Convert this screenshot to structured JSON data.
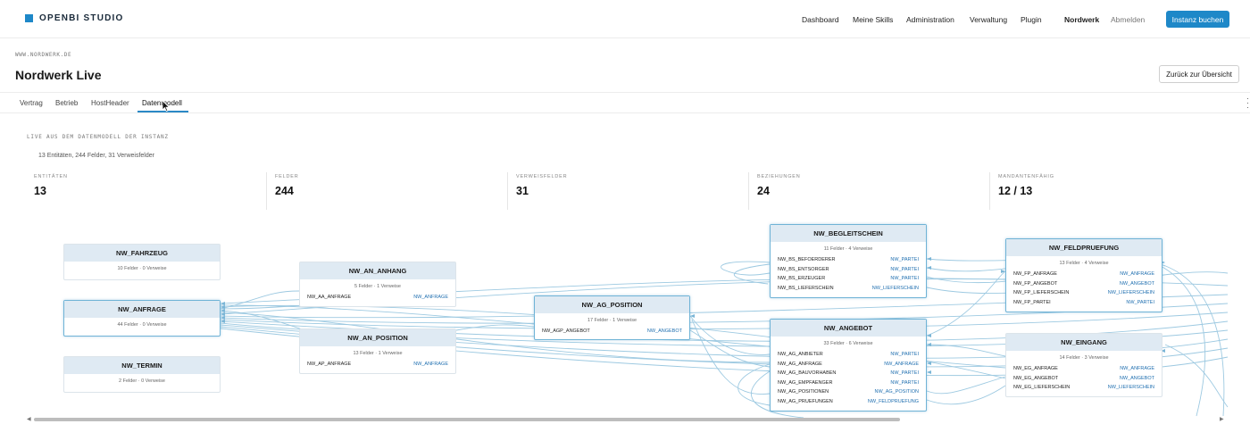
{
  "brand": {
    "name": "OPENBI STUDIO",
    "accent": "#1e88c8"
  },
  "nav": {
    "dashboard": "Dashboard",
    "skills": "Meine Skills",
    "admin": "Administration",
    "verwaltung": "Verwaltung",
    "plugin": "Plugin",
    "tenant": "Nordwerk",
    "logout": "Abmelden",
    "cta": "Instanz buchen"
  },
  "page": {
    "domain": "WWW.NORDWERK.DE",
    "title": "Nordwerk Live",
    "back_button": "Zurück zur Übersicht"
  },
  "tabs": [
    {
      "label": "Vertrag"
    },
    {
      "label": "Betrieb"
    },
    {
      "label": "HostHeader"
    },
    {
      "label": "Datenmodell",
      "active": true
    }
  ],
  "model": {
    "caption": "LIVE AUS DEM DATENMODELL DER INSTANZ",
    "summary": "13 Entitäten, 244 Felder, 31 Verweisfelder",
    "stats": [
      {
        "label": "ENTITÄTEN",
        "value": "13"
      },
      {
        "label": "FELDER",
        "value": "244"
      },
      {
        "label": "VERWEISFELDER",
        "value": "31"
      },
      {
        "label": "BEZIEHUNGEN",
        "value": "24"
      },
      {
        "label": "MANDANTENFÄHIG",
        "value": "12 / 13"
      }
    ]
  },
  "entities": {
    "fahrzeug": {
      "name": "NW_FAHRZEUG",
      "meta": "10 Felder · 0 Verweise",
      "rows": []
    },
    "anfrage": {
      "name": "NW_ANFRAGE",
      "meta": "44 Felder · 0 Verweise",
      "rows": []
    },
    "termin": {
      "name": "NW_TERMIN",
      "meta": "2 Felder · 0 Verweise",
      "rows": []
    },
    "an_anhang": {
      "name": "NW_AN_ANHANG",
      "meta": "5 Felder · 1 Verweise",
      "rows": [
        {
          "field": "NW_AA_ANFRAGE",
          "target": "NW_ANFRAGE"
        }
      ]
    },
    "an_position": {
      "name": "NW_AN_POSITION",
      "meta": "13 Felder · 1 Verweise",
      "rows": [
        {
          "field": "NW_AP_ANFRAGE",
          "target": "NW_ANFRAGE"
        }
      ]
    },
    "ag_position": {
      "name": "NW_AG_POSITION",
      "meta": "17 Felder · 1 Verweise",
      "rows": [
        {
          "field": "NW_AGP_ANGEBOT",
          "target": "NW_ANGEBOT"
        }
      ]
    },
    "begleitschein": {
      "name": "NW_BEGLEITSCHEIN",
      "meta": "11 Felder · 4 Verweise",
      "rows": [
        {
          "field": "NW_BS_BEFOERDERER",
          "target": "NW_PARTEI"
        },
        {
          "field": "NW_BS_ENTSORGER",
          "target": "NW_PARTEI"
        },
        {
          "field": "NW_BS_ERZEUGER",
          "target": "NW_PARTEI"
        },
        {
          "field": "NW_BS_LIEFERSCHEIN",
          "target": "NW_LIEFERSCHEIN"
        }
      ]
    },
    "angebot": {
      "name": "NW_ANGEBOT",
      "meta": "33 Felder · 6 Verweise",
      "rows": [
        {
          "field": "NW_AG_ANBIETER",
          "target": "NW_PARTEI"
        },
        {
          "field": "NW_AG_ANFRAGE",
          "target": "NW_ANFRAGE"
        },
        {
          "field": "NW_AG_BAUVORHABEN",
          "target": "NW_PARTEI"
        },
        {
          "field": "NW_AG_EMPFAENGER",
          "target": "NW_PARTEI"
        },
        {
          "field": "NW_AG_POSITIONEN",
          "target": "NW_AG_POSITION"
        },
        {
          "field": "NW_AG_PRUEFUNGEN",
          "target": "NW_FELDPRUEFUNG"
        }
      ]
    },
    "feldpruefung": {
      "name": "NW_FELDPRUEFUNG",
      "meta": "13 Felder · 4 Verweise",
      "rows": [
        {
          "field": "NW_FP_ANFRAGE",
          "target": "NW_ANFRAGE"
        },
        {
          "field": "NW_FP_ANGEBOT",
          "target": "NW_ANGEBOT"
        },
        {
          "field": "NW_FP_LIEFERSCHEIN",
          "target": "NW_LIEFERSCHEIN"
        },
        {
          "field": "NW_FP_PARTEI",
          "target": "NW_PARTEI"
        }
      ]
    },
    "eingang": {
      "name": "NW_EINGANG",
      "meta": "14 Felder · 3 Verweise",
      "rows": [
        {
          "field": "NW_EG_ANFRAGE",
          "target": "NW_ANFRAGE"
        },
        {
          "field": "NW_EG_ANGEBOT",
          "target": "NW_ANGEBOT"
        },
        {
          "field": "NW_EG_LIEFERSCHEIN",
          "target": "NW_LIEFERSCHEIN"
        }
      ]
    }
  }
}
